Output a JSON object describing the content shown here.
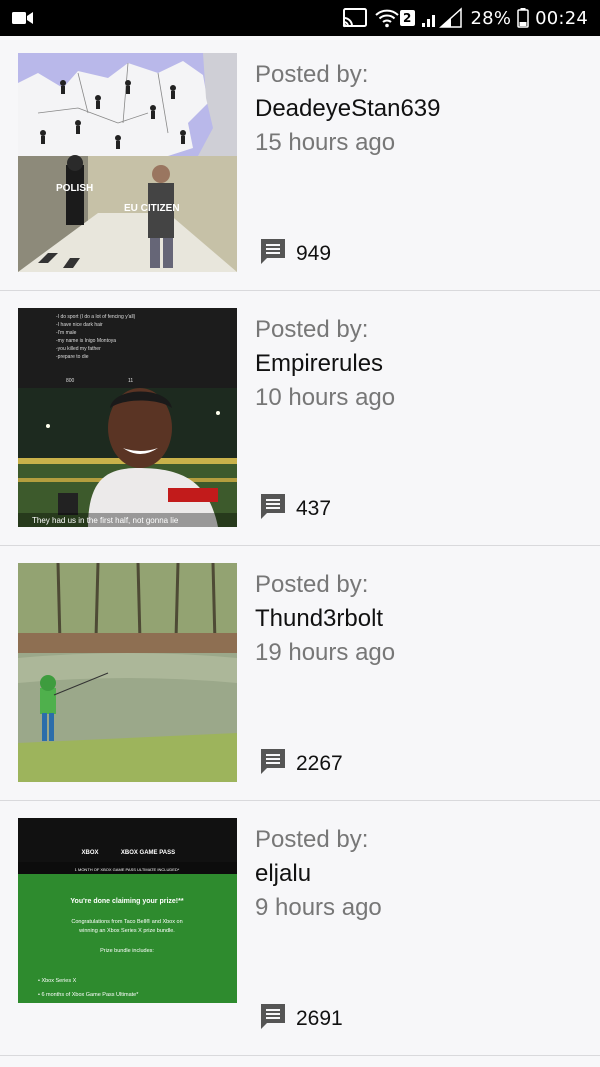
{
  "status_bar": {
    "sim_badge": "2",
    "battery": "28%",
    "time": "00:24",
    "icons": [
      "video-camera-icon",
      "cast-icon",
      "wifi-icon",
      "signal-icon",
      "battery-icon"
    ]
  },
  "posts": [
    {
      "posted_by_label": "Posted by:",
      "author": "DeadeyeStan639",
      "time": "15 hours ago",
      "comments": "949",
      "thumb_captions": [
        "POLISH",
        "EU CITIZEN"
      ]
    },
    {
      "posted_by_label": "Posted by:",
      "author": "Empirerules",
      "time": "10 hours ago",
      "comments": "437",
      "thumb_captions": [
        "-I do sport (I do a lot of fencing y'all)",
        "-I have nice dark hair",
        "-I'm male",
        "-my name is Inigo Montoya",
        "-you killed my father",
        "-prepare to die",
        "800",
        "11",
        "They had us in the first half, not gonna lie"
      ]
    },
    {
      "posted_by_label": "Posted by:",
      "author": "Thund3rbolt",
      "time": "19 hours ago",
      "comments": "2267",
      "thumb_captions": []
    },
    {
      "posted_by_label": "Posted by:",
      "author": "eljalu",
      "time": "9 hours ago",
      "comments": "2691",
      "thumb_captions": [
        "XBOX",
        "XBOX GAME PASS",
        "1 MONTH OF XBOX GAME PASS ULTIMATE INCLUDED*",
        "You're done claiming your prize!**",
        "Congratulations from Taco Bell® and Xbox on",
        "winning an Xbox Series X prize bundle.",
        "Prize bundle includes:",
        "• Xbox Series X",
        "• 6 months of Xbox Game Pass Ultimate*"
      ]
    }
  ],
  "colors": {
    "status_bar_bg": "#000000",
    "page_bg": "#f7f7f9",
    "muted_text": "#777777",
    "comment_icon": "#555555",
    "divider": "#d9d9dc"
  }
}
